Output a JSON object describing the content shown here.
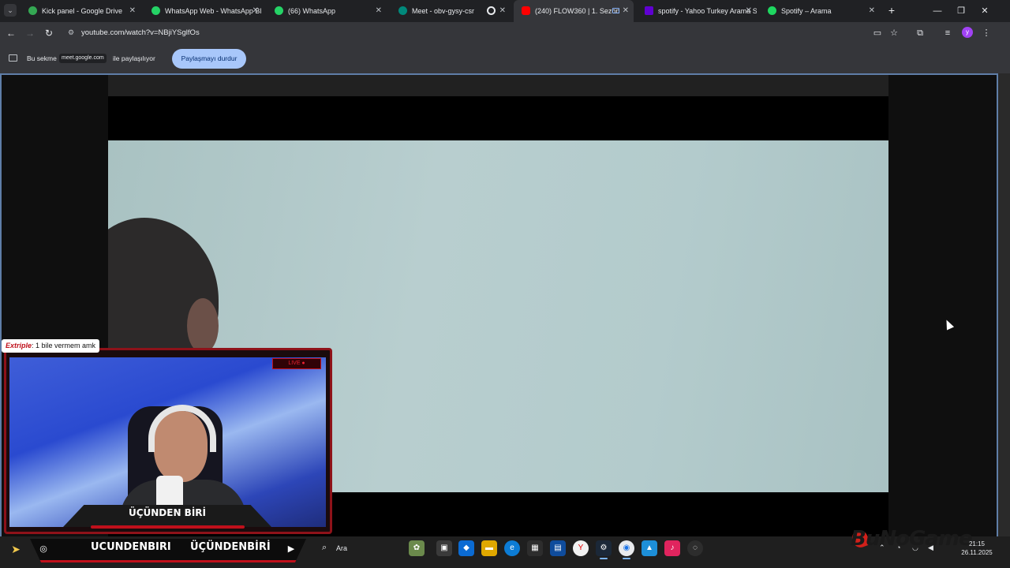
{
  "tabs": [
    {
      "label": "Kick panel - Google Drive",
      "icon": "google-drive-icon",
      "color": "#34a853"
    },
    {
      "label": "WhatsApp Web - WhatsApp Bl",
      "icon": "whatsapp-icon",
      "color": "#25d366"
    },
    {
      "label": "(66) WhatsApp",
      "icon": "whatsapp-icon",
      "color": "#25d366"
    },
    {
      "label": "Meet - obv-gysy-csr",
      "icon": "google-meet-icon",
      "color": "#00897b"
    },
    {
      "label": "",
      "icon": "recording-icon",
      "color": "#e8eaed"
    },
    {
      "label": "(240) FLOW360 | 1. Sezon",
      "icon": "youtube-icon",
      "color": "#ff0000"
    },
    {
      "label": "spotify - Yahoo Turkey Arama S",
      "icon": "yahoo-icon",
      "color": "#6001d2"
    },
    {
      "label": "Spotify – Arama",
      "icon": "spotify-icon",
      "color": "#1ed760"
    }
  ],
  "address_bar": {
    "url": "youtube.com/watch?v=NBjiYSglfOs"
  },
  "share_bar": {
    "text_before": "Bu sekme",
    "site_chip": "meet.google.com",
    "text_after": "ile paylaşılıyor",
    "stop_button": "Paylaşmayı durdur"
  },
  "stream_overlay": {
    "chat_user": "Extriple",
    "chat_message": ": 1 bile vermem amk",
    "live_badge": "LIVE ●",
    "streamer_name": "ÜÇÜNDEN BİRİ"
  },
  "taskbar": {
    "social_1": "UCUNDENBIRI",
    "social_2": "ÜÇÜNDENBİRİ",
    "search_label": "Ara",
    "watermark": "BuNoGame",
    "clock_time": "21:15",
    "clock_date": "26.11.2025"
  }
}
